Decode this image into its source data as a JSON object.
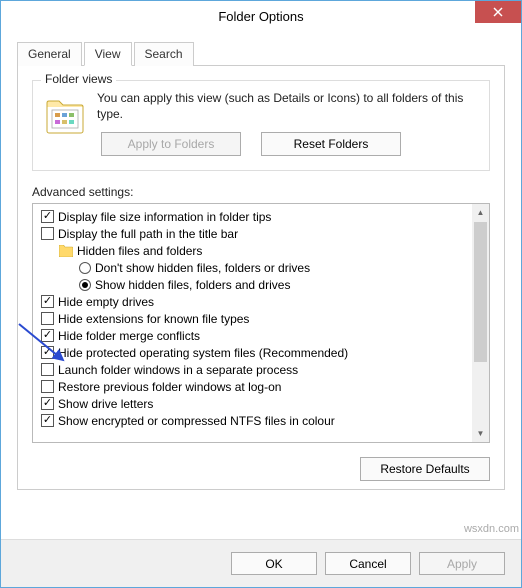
{
  "window": {
    "title": "Folder Options"
  },
  "tabs": {
    "general": "General",
    "view": "View",
    "search": "Search"
  },
  "folderviews": {
    "title": "Folder views",
    "desc": "You can apply this view (such as Details or Icons) to all folders of this type.",
    "apply": "Apply to Folders",
    "reset": "Reset Folders"
  },
  "advanced": {
    "label": "Advanced settings:",
    "items": [
      {
        "type": "checkbox",
        "checked": true,
        "label": "Display file size information in folder tips"
      },
      {
        "type": "checkbox",
        "checked": false,
        "label": "Display the full path in the title bar"
      },
      {
        "type": "folder",
        "label": "Hidden files and folders"
      },
      {
        "type": "radio",
        "checked": false,
        "label": "Don't show hidden files, folders or drives"
      },
      {
        "type": "radio",
        "checked": true,
        "label": "Show hidden files, folders and drives"
      },
      {
        "type": "checkbox",
        "checked": true,
        "label": "Hide empty drives"
      },
      {
        "type": "checkbox",
        "checked": false,
        "label": "Hide extensions for known file types"
      },
      {
        "type": "checkbox",
        "checked": true,
        "label": "Hide folder merge conflicts"
      },
      {
        "type": "checkbox",
        "checked": true,
        "label": "Hide protected operating system files (Recommended)"
      },
      {
        "type": "checkbox",
        "checked": false,
        "label": "Launch folder windows in a separate process"
      },
      {
        "type": "checkbox",
        "checked": false,
        "label": "Restore previous folder windows at log-on"
      },
      {
        "type": "checkbox",
        "checked": true,
        "label": "Show drive letters"
      },
      {
        "type": "checkbox",
        "checked": true,
        "label": "Show encrypted or compressed NTFS files in colour"
      }
    ],
    "restore": "Restore Defaults"
  },
  "footer": {
    "ok": "OK",
    "cancel": "Cancel",
    "apply": "Apply"
  },
  "watermark": "wsxdn.com"
}
